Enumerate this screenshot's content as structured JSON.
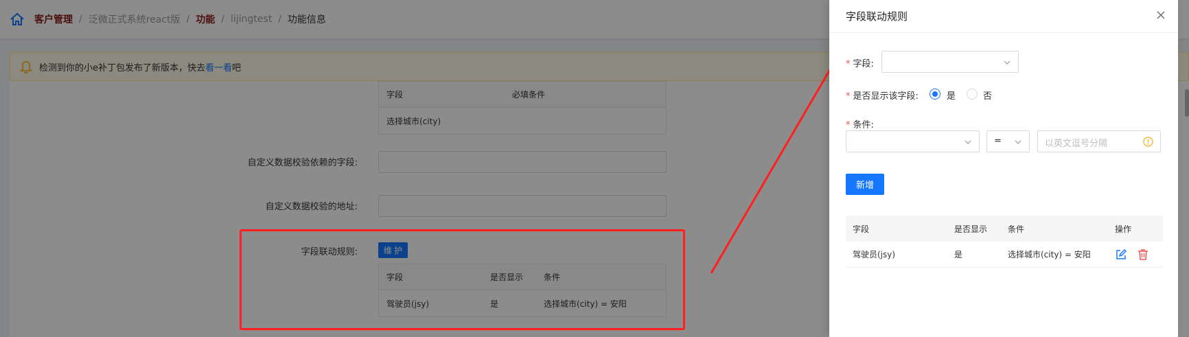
{
  "breadcrumb": {
    "items": [
      "客户管理",
      "泛微正式系统react版",
      "功能",
      "lijingtest",
      "功能信息"
    ],
    "separator": "/"
  },
  "notice": {
    "prefix": "检测到你的小e补丁包发布了新版本，快去",
    "link": "看一看",
    "suffix": "吧"
  },
  "background_form": {
    "required_table": {
      "headers": [
        "字段",
        "必填条件"
      ],
      "rows": [
        [
          "选择城市(city)",
          ""
        ]
      ]
    },
    "custom_field_label": "自定义数据校验依赖的字段:",
    "custom_url_label": "自定义数据校验的地址:",
    "linkage_label": "字段联动规则:",
    "maintain_button": "维 护",
    "linkage_table": {
      "headers": [
        "字段",
        "是否显示",
        "条件"
      ],
      "rows": [
        [
          "驾驶员(jsy)",
          "是",
          "选择城市(city) = 安阳"
        ]
      ]
    }
  },
  "drawer": {
    "title": "字段联动规则",
    "field_label": "字段:",
    "show_label": "是否显示该字段:",
    "show_options": [
      "是",
      "否"
    ],
    "show_selected": "是",
    "condition_label": "条件:",
    "operator_value": "=",
    "value_placeholder": "以英文逗号分隔",
    "add_button": "新增",
    "table": {
      "headers": [
        "字段",
        "是否显示",
        "条件",
        "操作"
      ],
      "rows": [
        {
          "field": "驾驶员(jsy)",
          "show": "是",
          "condition": "选择城市(city) = 安阳"
        }
      ]
    }
  },
  "colors": {
    "primary": "#1677ff",
    "annotation_red": "#ff1f1f",
    "breadcrumb_strong": "#8b1c1c",
    "delete": "#ff4d4f"
  }
}
